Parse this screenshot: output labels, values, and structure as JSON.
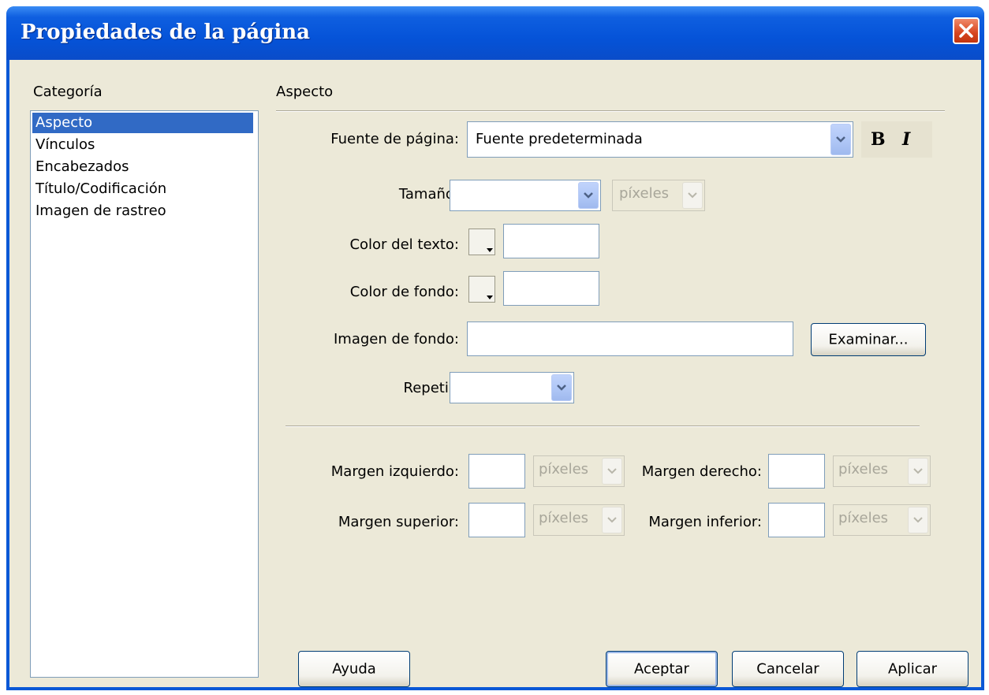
{
  "window": {
    "title": "Propiedades de la página"
  },
  "category": {
    "label": "Categoría",
    "items": [
      "Aspecto",
      "Vínculos",
      "Encabezados",
      "Título/Codificación",
      "Imagen de rastreo"
    ],
    "selected": "Aspecto"
  },
  "panel": {
    "heading": "Aspecto",
    "page_font": {
      "label": "Fuente de página:",
      "value": "Fuente predeterminada"
    },
    "bold_label": "B",
    "italic_label": "I",
    "size": {
      "label": "Tamaño:",
      "value": "",
      "unit": "píxeles"
    },
    "text_color": {
      "label": "Color del texto:",
      "value": ""
    },
    "bg_color": {
      "label": "Color de fondo:",
      "value": ""
    },
    "bg_image": {
      "label": "Imagen de fondo:",
      "value": "",
      "browse": "Examinar..."
    },
    "repeat": {
      "label": "Repetir:",
      "value": ""
    },
    "margins": {
      "left": {
        "label": "Margen izquierdo:",
        "value": "",
        "unit": "píxeles"
      },
      "right": {
        "label": "Margen derecho:",
        "value": "",
        "unit": "píxeles"
      },
      "top": {
        "label": "Margen superior:",
        "value": "",
        "unit": "píxeles"
      },
      "bottom": {
        "label": "Margen inferior:",
        "value": "",
        "unit": "píxeles"
      }
    }
  },
  "buttons": {
    "help": "Ayuda",
    "ok": "Aceptar",
    "cancel": "Cancelar",
    "apply": "Aplicar"
  },
  "colors": {
    "titlebar": "#0553d8",
    "selection": "#316ac5",
    "dialog_bg": "#ece9d8",
    "close": "#d7451f"
  }
}
